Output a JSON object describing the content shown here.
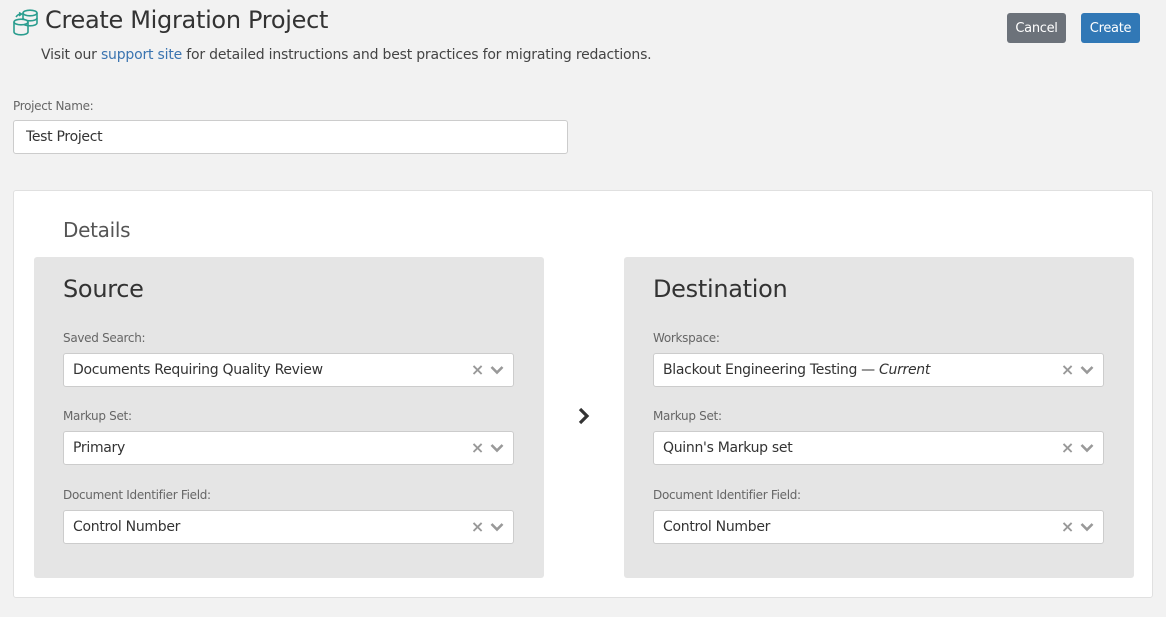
{
  "header": {
    "icon": "database-migration-icon",
    "title": "Create Migration Project",
    "subtitle_prefix": "Visit our ",
    "subtitle_link": "support site",
    "subtitle_suffix": " for detailed instructions and best practices for migrating redactions."
  },
  "toolbar": {
    "cancel_label": "Cancel",
    "create_label": "Create"
  },
  "project": {
    "label": "Project Name:",
    "value": "Test Project"
  },
  "details": {
    "title": "Details",
    "arrow_icon": "chevron-right-icon",
    "source": {
      "title": "Source",
      "fields": [
        {
          "label": "Saved Search:",
          "value": "Documents Requiring Quality Review"
        },
        {
          "label": "Markup Set:",
          "value": "Primary"
        },
        {
          "label": "Document Identifier Field:",
          "value": "Control Number"
        }
      ]
    },
    "destination": {
      "title": "Destination",
      "fields": [
        {
          "label": "Workspace:",
          "value": "Blackout Engineering Testing — ",
          "value_suffix": "Current"
        },
        {
          "label": "Markup Set:",
          "value": "Quinn's Markup set"
        },
        {
          "label": "Document Identifier Field:",
          "value": "Control Number"
        }
      ]
    }
  },
  "colors": {
    "accent": "#3178b6",
    "cancel": "#6c727a",
    "icon": "#2a9d8f",
    "link": "#3a74b0"
  },
  "select_icons": {
    "clear": "×",
    "dropdown": "chevron-down-icon"
  }
}
